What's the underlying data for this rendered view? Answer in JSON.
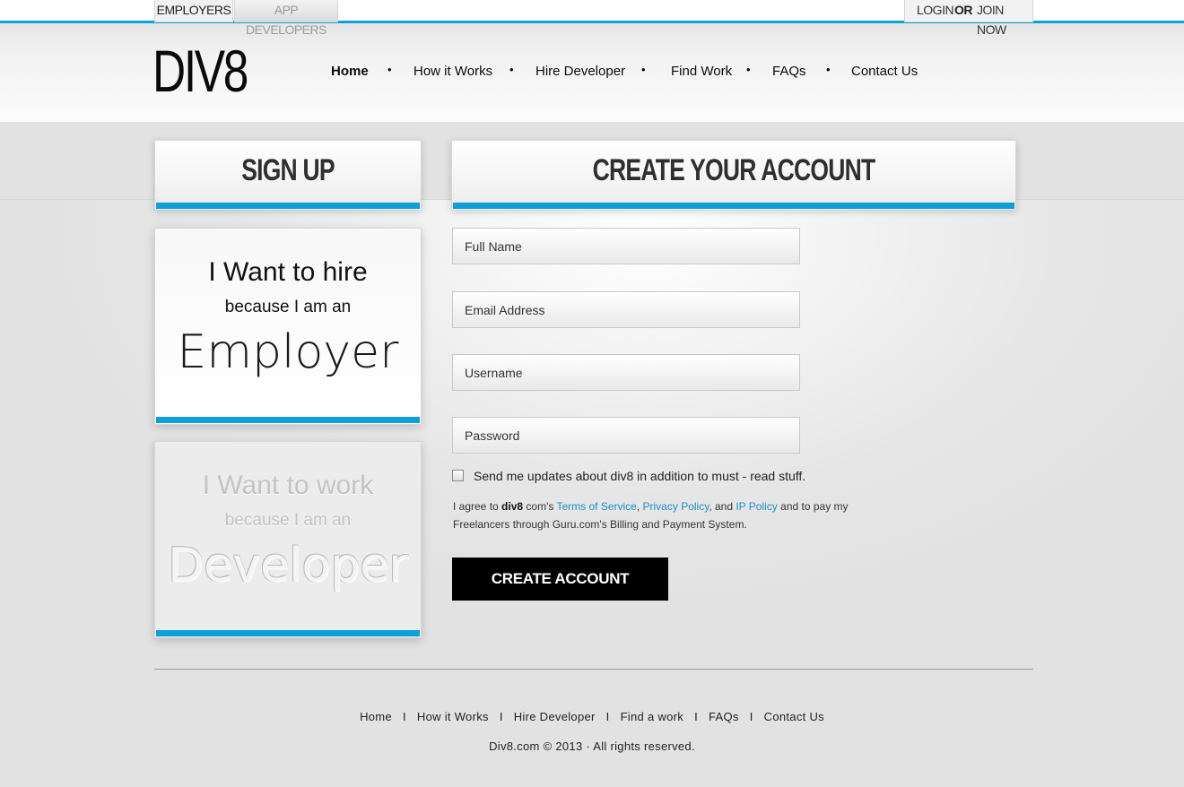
{
  "top_tabs": {
    "employers": "EMPLOYERS",
    "app_developers": "APP DEVELOPERS"
  },
  "account": {
    "login": "LOGIN",
    "or": "OR",
    "join": "JOIN NOW"
  },
  "logo": "DIV8",
  "nav": [
    "Home",
    "How it Works",
    "Hire Developer",
    "Find Work",
    "FAQs",
    "Contact Us"
  ],
  "nav_separator": "•",
  "signup": {
    "title": "SIGN UP",
    "employer": {
      "line1": "I Want to hire",
      "line2": "because I am an",
      "role": "Employer"
    },
    "developer": {
      "line1": "I Want to work",
      "line2": "because I am an",
      "role": "Developer"
    }
  },
  "create": {
    "title": "CREATE YOUR ACCOUNT",
    "fields": {
      "full_name": "Full Name",
      "email": "Email Address",
      "username": "Username",
      "password": "Password"
    },
    "checkbox_label": "Send me updates about div8 in addition to must - read stuff.",
    "checkbox_checked": false,
    "legal": {
      "prefix": "I agree to ",
      "brand": "div8",
      "mid": " com's ",
      "terms": "Terms of Service",
      "comma": ", ",
      "privacy": "Privacy Policy",
      "and": ", and ",
      "ip": "IP Policy",
      "suffix": " and to pay my Freelancers through Guru.com's Billing and Payment System."
    },
    "button": "CREATE ACCOUNT"
  },
  "footer": {
    "links": [
      "Home",
      "How it Works",
      "Hire Developer",
      "Find a work",
      "FAQs",
      "Contact Us"
    ],
    "separator": "I",
    "copyright": "Div8.com © 2013 · All rights reserved."
  },
  "colors": {
    "accent": "#0d9fd8",
    "button_bg": "#000000",
    "link": "#1a8fc7"
  }
}
